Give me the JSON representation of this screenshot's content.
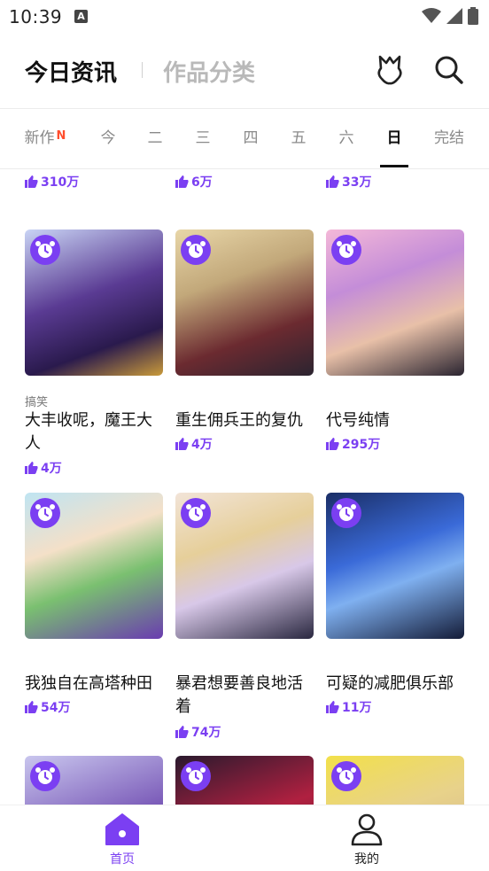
{
  "status_bar": {
    "time": "10:39",
    "notification_badge": "A"
  },
  "header": {
    "tab_today_news": "今日资讯",
    "tab_categories": "作品分类",
    "icons": [
      "badge-icon",
      "search-icon"
    ]
  },
  "day_tabs": [
    {
      "label": "新作",
      "badge": "N"
    },
    {
      "label": "今"
    },
    {
      "label": "二"
    },
    {
      "label": "三"
    },
    {
      "label": "四"
    },
    {
      "label": "五"
    },
    {
      "label": "六"
    },
    {
      "label": "日",
      "active": true
    },
    {
      "label": "完结"
    }
  ],
  "top_partial_row": {
    "likes": [
      "310万",
      "6万",
      "33万"
    ]
  },
  "comics": [
    {
      "genre": "搞笑",
      "title": "大丰收呢，魔王大人",
      "likes": "4万"
    },
    {
      "genre": "",
      "title": "重生佣兵王的复仇",
      "likes": "4万"
    },
    {
      "genre": "",
      "title": "代号纯情",
      "likes": "295万"
    },
    {
      "genre": "",
      "title": "我独自在高塔种田",
      "likes": "54万"
    },
    {
      "genre": "",
      "title": "暴君想要善良地活着",
      "likes": "74万"
    },
    {
      "genre": "",
      "title": "可疑的减肥俱乐部",
      "likes": "11万"
    }
  ],
  "bottom_nav": {
    "home_label": "首页",
    "mine_label": "我的",
    "accent_color": "#7b3ff2"
  }
}
